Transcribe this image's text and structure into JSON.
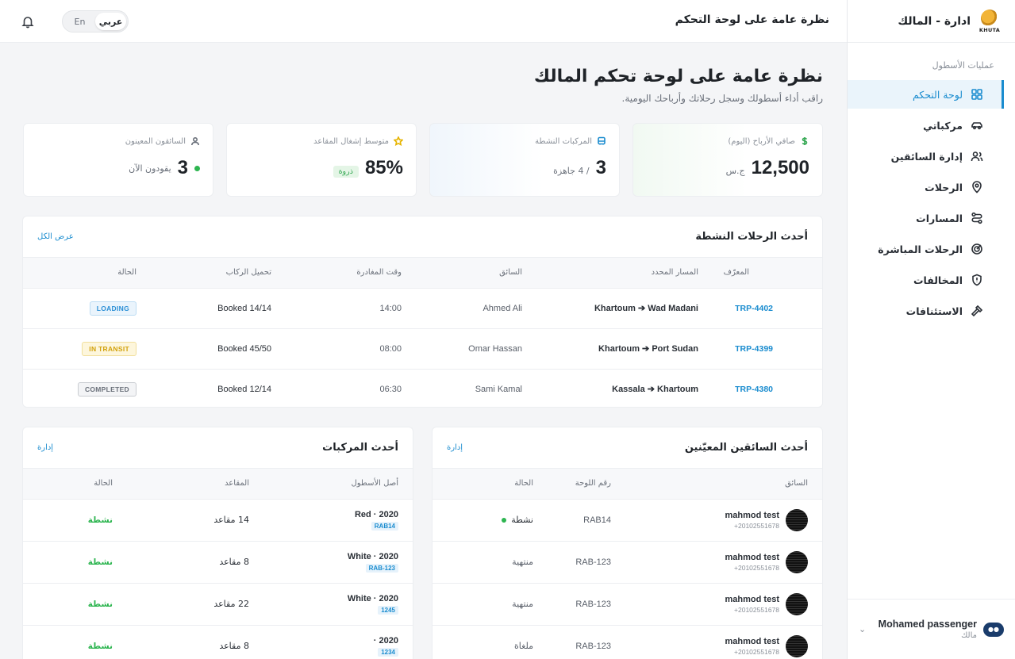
{
  "brand": {
    "title": "ادارة - المالك",
    "logo_text": "KHUTA"
  },
  "sidebar": {
    "section_label": "عمليات الأسطول",
    "items": [
      {
        "label": "لوحة التحكم",
        "icon": "dashboard-icon"
      },
      {
        "label": "مركباتي",
        "icon": "car-icon"
      },
      {
        "label": "إدارة السائقين",
        "icon": "users-icon"
      },
      {
        "label": "الرحلات",
        "icon": "map-pin-icon"
      },
      {
        "label": "المسارات",
        "icon": "route-icon"
      },
      {
        "label": "الرحلات المباشرة",
        "icon": "live-icon"
      },
      {
        "label": "المخالفات",
        "icon": "shield-icon"
      },
      {
        "label": "الاستئنافات",
        "icon": "gavel-icon"
      }
    ],
    "user": {
      "name": "Mohamed passenger",
      "role": "مالك"
    }
  },
  "topbar": {
    "title": "نظرة عامة على لوحة التحكم",
    "lang_ar": "عربي",
    "lang_en": "En"
  },
  "page": {
    "title": "نظرة عامة على لوحة تحكم المالك",
    "subtitle": "راقب أداء أسطولك وسجل رحلاتك وأرباحك اليومية."
  },
  "stats": {
    "profit": {
      "label": "صافي الأرباح (اليوم)",
      "value": "12,500",
      "unit": "ج.س",
      "accent": "#34a853"
    },
    "vehicles": {
      "label": "المركبات النشطة",
      "value": "3",
      "unit": "/ 4 جاهزة",
      "accent": "#1a8ccf"
    },
    "occupancy": {
      "label": "متوسط إشغال المقاعد",
      "value": "85%",
      "badge": "ذروة",
      "accent": "#e6b400"
    },
    "drivers": {
      "label": "السائقون المعينون",
      "value": "3",
      "unit": "يقودون الآن"
    }
  },
  "trips": {
    "title": "أحدث الرحلات النشطة",
    "view_all": "عرض الكل",
    "columns": [
      "المعرّف",
      "المسار المحدد",
      "السائق",
      "وقت المغادرة",
      "تحميل الركاب",
      "الحالة"
    ],
    "rows": [
      {
        "id": "TRP-4402",
        "route": "Khartoum ➔ Wad Madani",
        "driver": "Ahmed Ali",
        "time": "14:00",
        "load": "Booked 14/14",
        "status": "LOADING"
      },
      {
        "id": "TRP-4399",
        "route": "Khartoum ➔ Port Sudan",
        "driver": "Omar Hassan",
        "time": "08:00",
        "load": "Booked 45/50",
        "status": "IN TRANSIT"
      },
      {
        "id": "TRP-4380",
        "route": "Kassala ➔ Khartoum",
        "driver": "Sami Kamal",
        "time": "06:30",
        "load": "Booked 12/14",
        "status": "COMPLETED"
      }
    ]
  },
  "drivers": {
    "title": "أحدث السائقين المعيّنين",
    "manage": "إدارة",
    "columns": [
      "السائق",
      "رقم اللوحة",
      "الحالة"
    ],
    "rows": [
      {
        "name": "mahmod test",
        "phone": "+20102551678",
        "plate": "RAB14",
        "status": "نشطة"
      },
      {
        "name": "mahmod test",
        "phone": "+20102551678",
        "plate": "RAB-123",
        "status": "منتهية"
      },
      {
        "name": "mahmod test",
        "phone": "+20102551678",
        "plate": "RAB-123",
        "status": "منتهية"
      },
      {
        "name": "mahmod test",
        "phone": "+20102551678",
        "plate": "RAB-123",
        "status": "ملغاة"
      }
    ]
  },
  "vehicles": {
    "title": "أحدث المركبات",
    "manage": "إدارة",
    "columns": [
      "أصل الأسطول",
      "المقاعد",
      "الحالة"
    ],
    "rows": [
      {
        "name": "Red · 2020",
        "plate": "RAB14",
        "seats": "14 مقاعد",
        "status": "نشطة"
      },
      {
        "name": "White · 2020",
        "plate": "RAB-123",
        "seats": "8 مقاعد",
        "status": "نشطة"
      },
      {
        "name": "White · 2020",
        "plate": "1245",
        "seats": "22 مقاعد",
        "status": "نشطة"
      },
      {
        "name": "· 2020",
        "plate": "1234",
        "seats": "8 مقاعد",
        "status": "نشطة"
      }
    ]
  }
}
